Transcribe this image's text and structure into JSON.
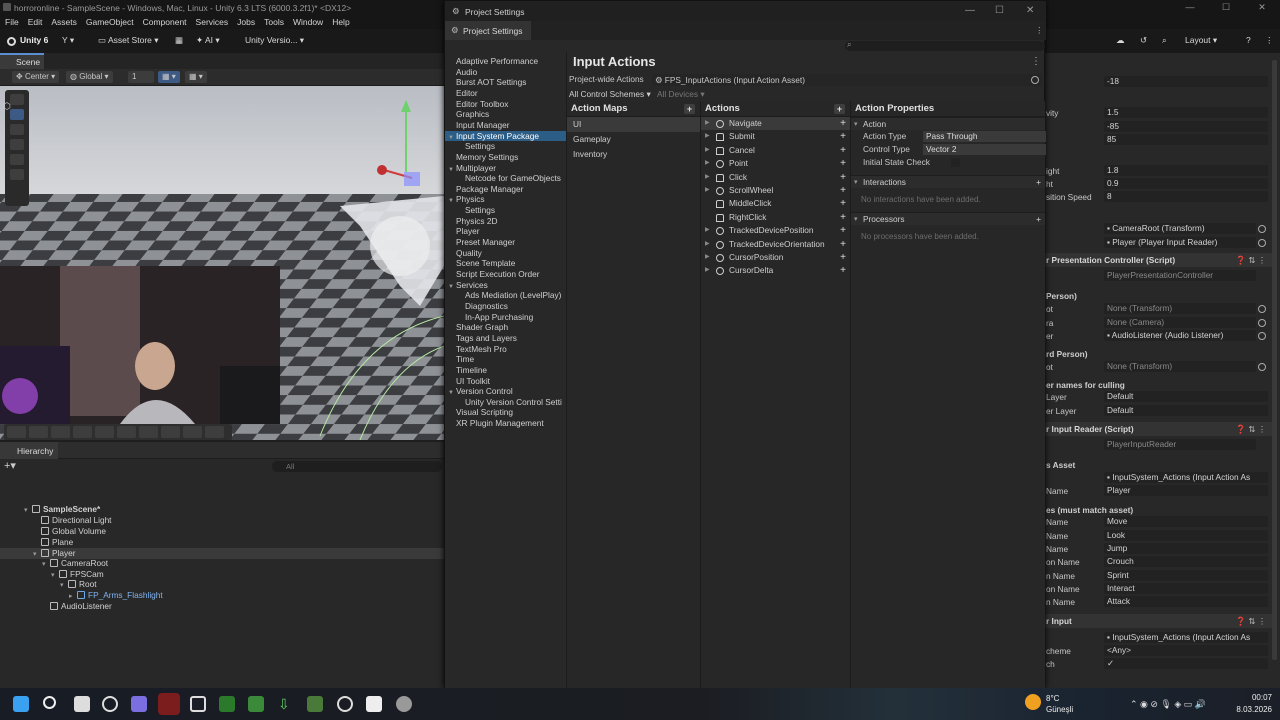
{
  "window": {
    "title": "horroronline - SampleScene - Windows, Mac, Linux - Unity 6.3 LTS (6000.3.2f1)* <DX12>",
    "controls": [
      "—",
      "☐",
      "✕"
    ]
  },
  "menu": [
    "File",
    "Edit",
    "Assets",
    "GameObject",
    "Component",
    "Services",
    "Jobs",
    "Tools",
    "Window",
    "Help"
  ],
  "toolbar": {
    "unity_label": "Unity 6",
    "account_label": "Y",
    "asset_store": "Asset Store",
    "ai_label": "AI",
    "version_label": "Unity Versio...",
    "layout_label": "Layout"
  },
  "scene": {
    "tab": "Scene",
    "pivot": "Center",
    "space": "Global",
    "value": "1"
  },
  "hierarchy": {
    "tab": "Hierarchy",
    "search_placeholder": "All",
    "items": [
      {
        "label": "SampleScene*",
        "depth": 0
      },
      {
        "label": "Directional Light",
        "depth": 1
      },
      {
        "label": "Global Volume",
        "depth": 1
      },
      {
        "label": "Plane",
        "depth": 1
      },
      {
        "label": "Player",
        "depth": 1
      },
      {
        "label": "CameraRoot",
        "depth": 2
      },
      {
        "label": "FPSCam",
        "depth": 3
      },
      {
        "label": "Root",
        "depth": 4
      },
      {
        "label": "FP_Arms_Flashlight",
        "depth": 5
      },
      {
        "label": "AudioListener",
        "depth": 2
      }
    ]
  },
  "project_settings": {
    "title": "Project Settings",
    "tab": "Project Settings",
    "nav": [
      {
        "label": "Adaptive Performance",
        "indent": 0
      },
      {
        "label": "Audio",
        "indent": 0
      },
      {
        "label": "Burst AOT Settings",
        "indent": 0
      },
      {
        "label": "Editor",
        "indent": 0
      },
      {
        "label": "Editor Toolbox",
        "indent": 0
      },
      {
        "label": "Graphics",
        "indent": 0
      },
      {
        "label": "Input Manager",
        "indent": 0
      },
      {
        "label": "Input System Package",
        "indent": 0,
        "expand": true
      },
      {
        "label": "Settings",
        "indent": 1
      },
      {
        "label": "Memory Settings",
        "indent": 0
      },
      {
        "label": "Multiplayer",
        "indent": 0,
        "expand": true
      },
      {
        "label": "Netcode for GameObjects",
        "indent": 1
      },
      {
        "label": "Package Manager",
        "indent": 0
      },
      {
        "label": "Physics",
        "indent": 0,
        "expand": true
      },
      {
        "label": "Settings",
        "indent": 1
      },
      {
        "label": "Physics 2D",
        "indent": 0
      },
      {
        "label": "Player",
        "indent": 0
      },
      {
        "label": "Preset Manager",
        "indent": 0
      },
      {
        "label": "Quality",
        "indent": 0
      },
      {
        "label": "Scene Template",
        "indent": 0
      },
      {
        "label": "Script Execution Order",
        "indent": 0
      },
      {
        "label": "Services",
        "indent": 0,
        "expand": true
      },
      {
        "label": "Ads Mediation (LevelPlay)",
        "indent": 1
      },
      {
        "label": "Diagnostics",
        "indent": 1
      },
      {
        "label": "In-App Purchasing",
        "indent": 1
      },
      {
        "label": "Shader Graph",
        "indent": 0
      },
      {
        "label": "Tags and Layers",
        "indent": 0
      },
      {
        "label": "TextMesh Pro",
        "indent": 0
      },
      {
        "label": "Time",
        "indent": 0
      },
      {
        "label": "Timeline",
        "indent": 0
      },
      {
        "label": "UI Toolkit",
        "indent": 0
      },
      {
        "label": "Version Control",
        "indent": 0,
        "expand": true
      },
      {
        "label": "Unity Version Control Setti",
        "indent": 1
      },
      {
        "label": "Visual Scripting",
        "indent": 0
      },
      {
        "label": "XR Plugin Management",
        "indent": 0
      }
    ],
    "input_actions": {
      "heading": "Input Actions",
      "project_wide_label": "Project-wide Actions",
      "project_wide_value": "FPS_InputActions (Input Action Asset)",
      "control_schemes": "All Control Schemes",
      "devices": "All Devices",
      "maps_header": "Action Maps",
      "maps": [
        "UI",
        "Gameplay",
        "Inventory"
      ],
      "actions_header": "Actions",
      "actions": [
        {
          "label": "Navigate",
          "icon": "circle"
        },
        {
          "label": "Submit",
          "icon": "person"
        },
        {
          "label": "Cancel",
          "icon": "person"
        },
        {
          "label": "Point",
          "icon": "circle"
        },
        {
          "label": "Click",
          "icon": "person"
        },
        {
          "label": "ScrollWheel",
          "icon": "circle"
        },
        {
          "label": "MiddleClick",
          "icon": "person"
        },
        {
          "label": "RightClick",
          "icon": "person"
        },
        {
          "label": "TrackedDevicePosition",
          "icon": "circle"
        },
        {
          "label": "TrackedDeviceOrientation",
          "icon": "circle"
        },
        {
          "label": "CursorPosition",
          "icon": "circle"
        },
        {
          "label": "CursorDelta",
          "icon": "circle"
        }
      ],
      "props_header": "Action Properties",
      "action_section": "Action",
      "action_type_label": "Action Type",
      "action_type_value": "Pass Through",
      "control_type_label": "Control Type",
      "control_type_value": "Vector 2",
      "initial_state_label": "Initial State Check",
      "interactions_section": "Interactions",
      "interactions_empty": "No interactions have been added.",
      "processors_section": "Processors",
      "processors_empty": "No processors have been added."
    }
  },
  "inspector": {
    "rows": [
      {
        "label": "",
        "value": "-18"
      },
      {
        "label": "vity",
        "value": "1.5"
      },
      {
        "label": "",
        "value": "-85"
      },
      {
        "label": "",
        "value": "85"
      },
      {
        "label": "ight",
        "value": "1.8"
      },
      {
        "label": "ht",
        "value": "0.9"
      },
      {
        "label": "sition Speed",
        "value": "8"
      },
      {
        "label": "",
        "value": "CameraRoot (Transform)"
      },
      {
        "label": "",
        "value": "Player (Player Input Reader)"
      }
    ],
    "presentation_header": "r Presentation Controller (Script)",
    "presentation_script": "PlayerPresentationController",
    "fp_label": "Person)",
    "fp_rows": [
      {
        "label": "ot",
        "value": "None (Transform)"
      },
      {
        "label": "ra",
        "value": "None (Camera)"
      },
      {
        "label": "er",
        "value": "AudioListener (Audio Listener)"
      }
    ],
    "tp_label": "rd Person)",
    "tp_rows": [
      {
        "label": "ot",
        "value": "None (Transform)"
      }
    ],
    "culling_label": "er names for culling",
    "culling_rows": [
      {
        "label": "Layer",
        "value": "Default"
      },
      {
        "label": "er Layer",
        "value": "Default"
      }
    ],
    "reader_header": "r Input Reader (Script)",
    "reader_script": "PlayerInputReader",
    "asset_label": "s Asset",
    "asset_rows": [
      {
        "label": "",
        "value": "InputSystem_Actions (Input Action As"
      },
      {
        "label": "Name",
        "value": "Player"
      }
    ],
    "must_match_label": "es (must match asset)",
    "names": [
      {
        "label": "Name",
        "value": "Move"
      },
      {
        "label": "Name",
        "value": "Look"
      },
      {
        "label": "Name",
        "value": "Jump"
      },
      {
        "label": "on Name",
        "value": "Crouch"
      },
      {
        "label": "n Name",
        "value": "Sprint"
      },
      {
        "label": "on Name",
        "value": "Interact"
      },
      {
        "label": "n Name",
        "value": "Attack"
      }
    ],
    "player_input_header": "r Input",
    "pi_rows": [
      {
        "label": "",
        "value": "InputSystem_Actions (Input Action As"
      },
      {
        "label": "cheme",
        "value": "<Any>"
      },
      {
        "label": "ch",
        "value": "✓"
      }
    ]
  },
  "taskbar": {
    "temperature": "8°C",
    "weather": "Güneşli",
    "time": "00:07",
    "date": "8.03.2026"
  },
  "colors": {
    "accent": "#2c5d87",
    "panel": "#282828",
    "selection": "#3a3a3a"
  }
}
